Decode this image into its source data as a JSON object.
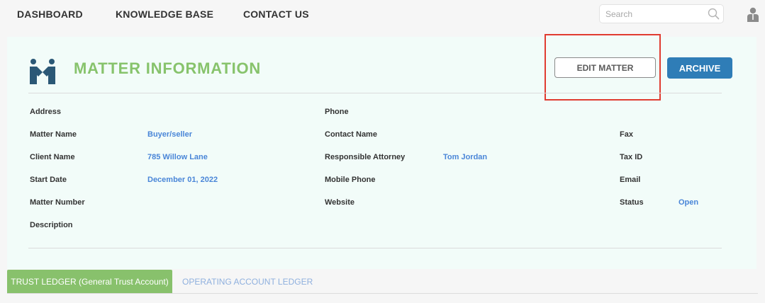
{
  "nav": {
    "items": [
      "DASHBOARD",
      "KNOWLEDGE BASE",
      "CONTACT US"
    ],
    "search_placeholder": "Search"
  },
  "header": {
    "title": "MATTER INFORMATION",
    "edit_label": "EDIT MATTER",
    "archive_label": "ARCHIVE"
  },
  "fields": {
    "address": {
      "label": "Address",
      "value": ""
    },
    "phone": {
      "label": "Phone",
      "value": ""
    },
    "matter_name": {
      "label": "Matter Name",
      "value": "Buyer/seller"
    },
    "contact_name": {
      "label": "Contact Name",
      "value": ""
    },
    "fax": {
      "label": "Fax",
      "value": ""
    },
    "client_name": {
      "label": "Client Name",
      "value": "785 Willow Lane"
    },
    "responsible_attorney": {
      "label": "Responsible Attorney",
      "value": "Tom Jordan"
    },
    "tax_id": {
      "label": "Tax ID",
      "value": ""
    },
    "start_date": {
      "label": "Start Date",
      "value": "December 01, 2022"
    },
    "mobile_phone": {
      "label": "Mobile Phone",
      "value": ""
    },
    "email": {
      "label": "Email",
      "value": ""
    },
    "matter_number": {
      "label": "Matter Number",
      "value": ""
    },
    "website": {
      "label": "Website",
      "value": ""
    },
    "status": {
      "label": "Status",
      "value": "Open"
    },
    "description": {
      "label": "Description",
      "value": ""
    }
  },
  "tabs": [
    "TRUST LEDGER (General Trust Account)",
    "OPERATING ACCOUNT LEDGER"
  ],
  "colors": {
    "accent_green": "#87c36c",
    "primary_blue": "#2f7db7",
    "value_blue": "#4a86d8",
    "highlight_red": "#e03c31"
  },
  "icons": [
    "search-icon",
    "user-icon",
    "handshake-logo-icon"
  ]
}
